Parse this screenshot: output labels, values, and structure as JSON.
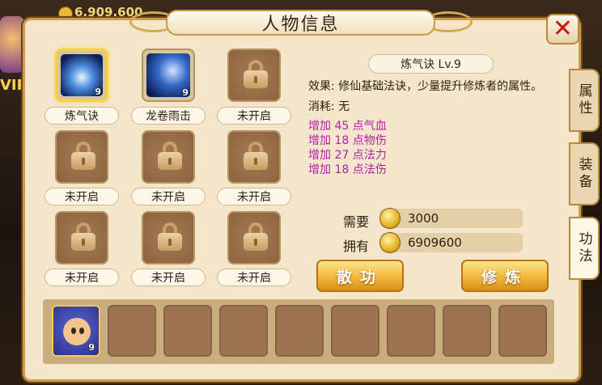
{
  "background": {
    "gold_amount": "6,909,600",
    "vip_label": "VIP"
  },
  "window": {
    "title": "人物信息",
    "close_symbol": "✕"
  },
  "side_tabs": [
    {
      "label": "属性",
      "active": false
    },
    {
      "label": "装备",
      "active": false
    },
    {
      "label": "功法",
      "active": true
    }
  ],
  "skills": [
    {
      "name": "炼气诀",
      "level": "9",
      "locked": false,
      "selected": true,
      "icon": "meditating-figure-icon"
    },
    {
      "name": "龙卷雨击",
      "level": "9",
      "locked": false,
      "selected": false,
      "icon": "tornado-rain-icon"
    },
    {
      "name": "未开启",
      "level": "",
      "locked": true,
      "selected": false,
      "icon": "padlock-icon"
    },
    {
      "name": "未开启",
      "level": "",
      "locked": true,
      "selected": false,
      "icon": "padlock-icon"
    },
    {
      "name": "未开启",
      "level": "",
      "locked": true,
      "selected": false,
      "icon": "padlock-icon"
    },
    {
      "name": "未开启",
      "level": "",
      "locked": true,
      "selected": false,
      "icon": "padlock-icon"
    },
    {
      "name": "未开启",
      "level": "",
      "locked": true,
      "selected": false,
      "icon": "padlock-icon"
    },
    {
      "name": "未开启",
      "level": "",
      "locked": true,
      "selected": false,
      "icon": "padlock-icon"
    },
    {
      "name": "未开启",
      "level": "",
      "locked": true,
      "selected": false,
      "icon": "padlock-icon"
    }
  ],
  "detail": {
    "skill_title": "炼气诀 Lv.9",
    "effect": "效果: 修仙基础法诀，少量提升修炼者的属性。",
    "cost": "消耗: 无",
    "bonuses": [
      "增加 45 点气血",
      "增加 18 点物伤",
      "增加 27 点法力",
      "增加 18 点法伤"
    ],
    "need_label": "需要",
    "need_value": "3000",
    "have_label": "拥有",
    "have_value": "6909600"
  },
  "buttons": {
    "dismiss": "散功",
    "cultivate": "修炼"
  },
  "pet_slot": {
    "level": "9"
  },
  "colors": {
    "panel": "#f3e6cb",
    "accent_gold": "#f0b83a",
    "bonus_text": "#b41fa5",
    "close_red": "#c41616"
  }
}
